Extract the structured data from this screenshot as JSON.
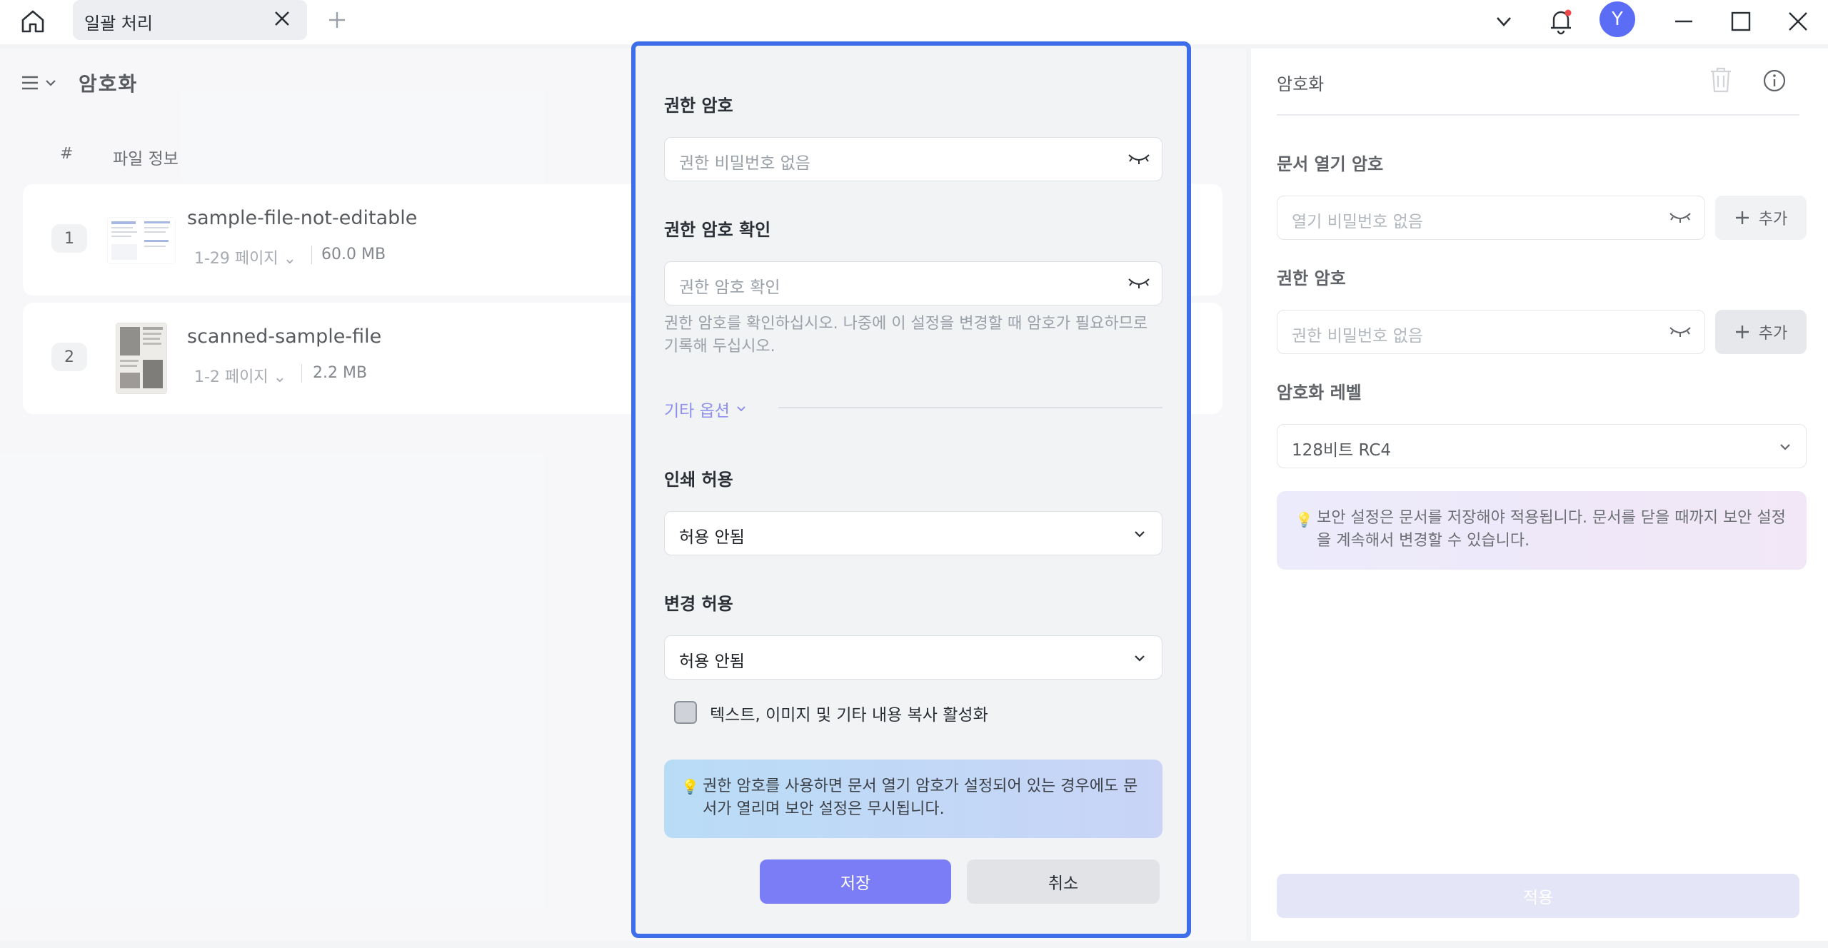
{
  "titlebar": {
    "tab_title": "일괄 처리",
    "icons": [
      "home-icon",
      "close-icon",
      "plus-icon",
      "chevron-down-icon",
      "bell-icon",
      "minimize-icon",
      "maximize-icon",
      "close-window-icon"
    ],
    "avatar_letter": "Y"
  },
  "left_panel": {
    "title": "암호화",
    "col_num": "#",
    "col_info": "파일 정보",
    "files": [
      {
        "num": "1",
        "name": "sample-file-not-editable",
        "pages": "1-29 페이지",
        "size": "60.0 MB"
      },
      {
        "num": "2",
        "name": "scanned-sample-file",
        "pages": "1-2 페이지",
        "size": "2.2 MB"
      }
    ]
  },
  "right_panel": {
    "title": "암호화",
    "open_pw_label": "문서 열기 암호",
    "open_pw_placeholder": "열기 비밀번호 없음",
    "perm_pw_label": "권한 암호",
    "perm_pw_placeholder": "권한 비밀번호 없음",
    "add_label": "추가",
    "level_label": "암호화 레벨",
    "level_value": "128비트 RC4",
    "note": "보안 설정은 문서를 저장해야 적용됩니다. 문서를 닫을 때까지 보안 설정을 계속해서 변경할 수 있습니다.",
    "apply_label": "적용"
  },
  "dialog": {
    "perm_pw_label": "권한 암호",
    "perm_pw_placeholder": "권한 비밀번호 없음",
    "confirm_label": "권한 암호 확인",
    "confirm_placeholder": "권한 암호 확인",
    "help_text": "권한 암호를 확인하십시오. 나중에 이 설정을 변경할 때 암호가 필요하므로 기록해 두십시오.",
    "more_options": "기타 옵션",
    "print_label": "인쇄 허용",
    "print_value": "허용 안됨",
    "change_label": "변경 허용",
    "change_value": "허용 안됨",
    "copy_label": "텍스트, 이미지 및 기타 내용 복사 활성화",
    "note": "권한 암호를 사용하면 문서 열기 암호가 설정되어 있는 경우에도 문서가 열리며 보안 설정은 무시됩니다.",
    "save_label": "저장",
    "cancel_label": "취소"
  },
  "colors": {
    "accent": "#7b7df6",
    "dialog_border": "#3d6de8",
    "avatar": "#5b6cf5"
  }
}
